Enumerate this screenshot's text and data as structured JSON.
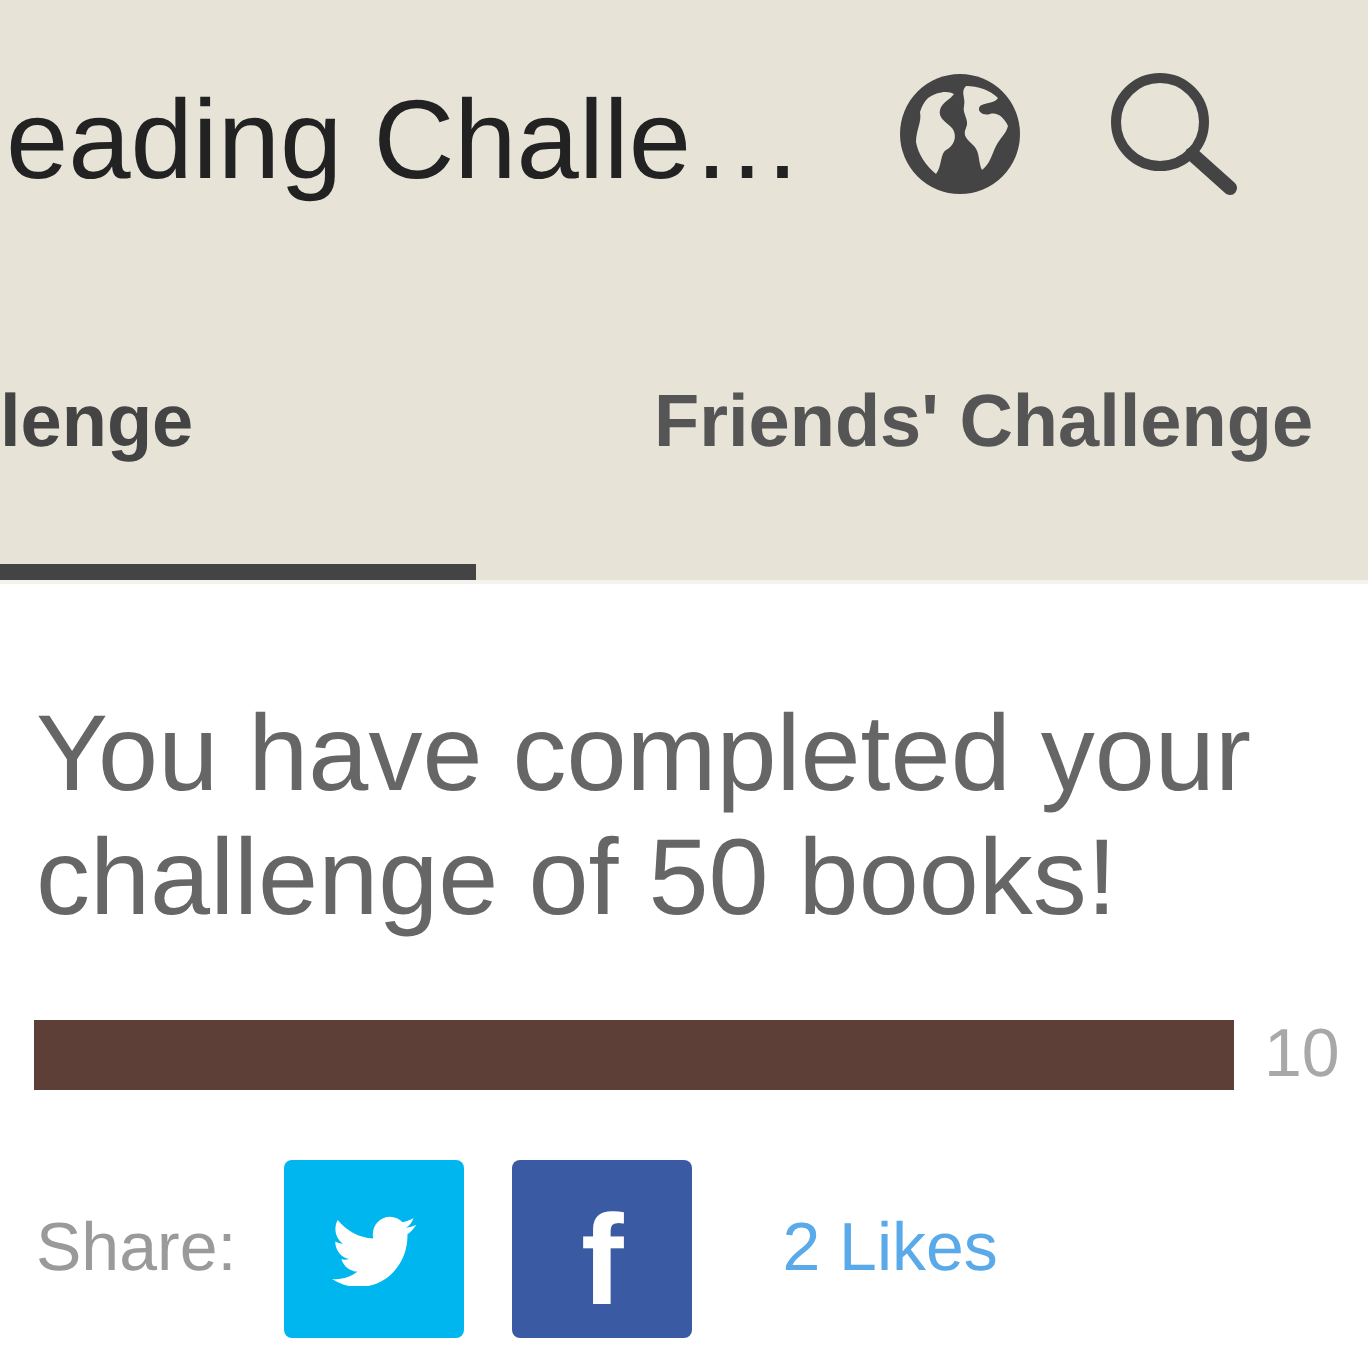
{
  "app_bar": {
    "title": "eading Challe…"
  },
  "tabs": [
    {
      "label": "lenge",
      "selected": true
    },
    {
      "label": "Friends' Challenge",
      "selected": false
    }
  ],
  "challenge": {
    "message": "You have completed your challenge of 50 books!",
    "progress": {
      "level": 1,
      "reading": "10"
    }
  },
  "share": {
    "label": "Share:",
    "buttons": [
      {
        "kind": "twitter"
      },
      {
        "kind": "facebook",
        "label": "f"
      }
    ],
    "likes": "2 Likes"
  }
}
